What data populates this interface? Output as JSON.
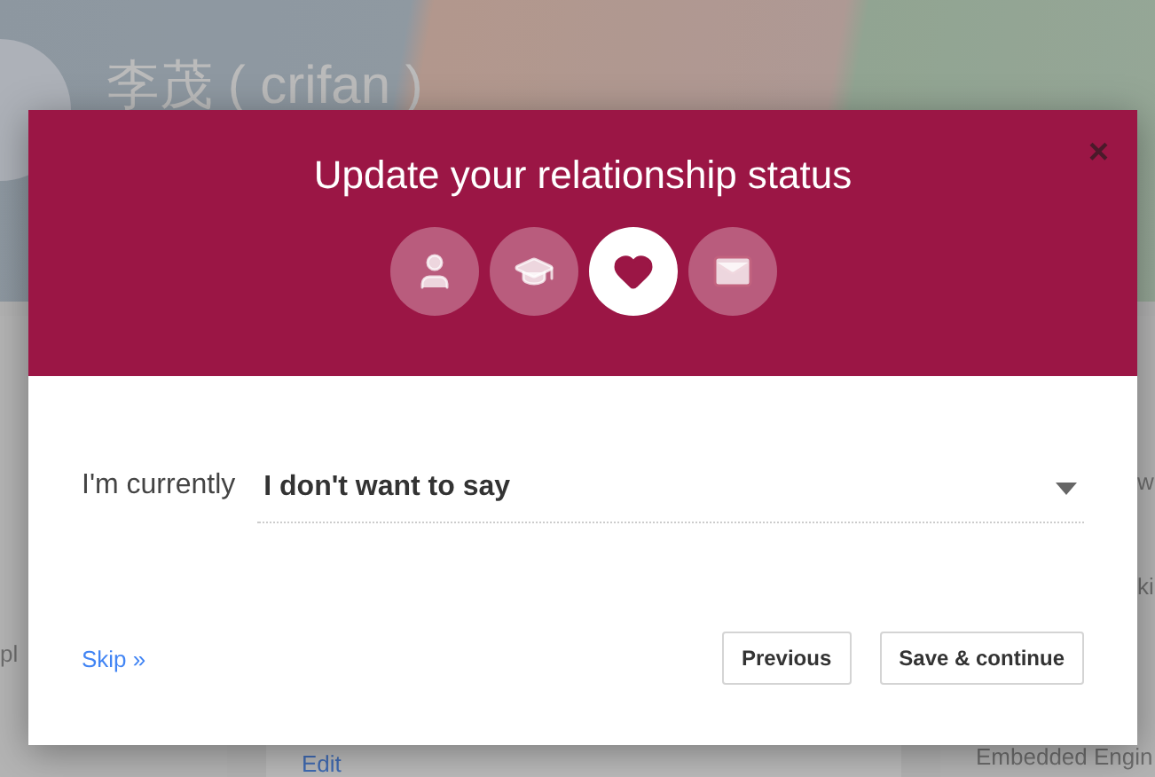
{
  "profile": {
    "name": "李茂 ( crifan )"
  },
  "background": {
    "left_column": [
      "pl"
    ],
    "center_column": [
      "Edit"
    ],
    "right_column": [
      "w",
      "ki",
      "Embedded Engin"
    ]
  },
  "dialog": {
    "title": "Update your relationship status",
    "close": "×",
    "steps": [
      {
        "kind": "person",
        "selected": false
      },
      {
        "kind": "school",
        "selected": false
      },
      {
        "kind": "heart",
        "selected": true
      },
      {
        "kind": "mail",
        "selected": false
      }
    ],
    "field": {
      "label": "I'm currently",
      "value": "I don't want to say"
    },
    "skip": "Skip »",
    "buttons": [
      "Previous",
      "Save & continue"
    ]
  }
}
